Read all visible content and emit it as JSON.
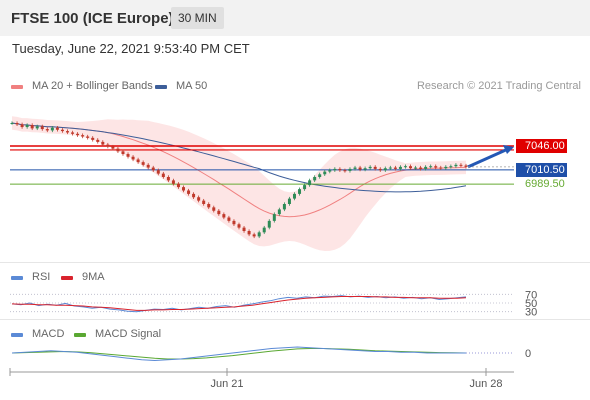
{
  "header": {
    "title": "FTSE 100 (ICE Europe)",
    "interval": "30 MIN"
  },
  "datetime": "Tuesday, June 22, 2021 9:53:40 PM CET",
  "credit": "Research © 2021 Trading Central",
  "colors": {
    "ma20": "#f08080",
    "bollinger_fill": "#fde0e0",
    "ma50": "#3d5e99",
    "resistance": "#e00000",
    "pivot": "#1e4fa8",
    "support": "#66aa33",
    "candle_up": "#2e8b57",
    "candle_down": "#c0392b",
    "arrow": "#2458b5",
    "rsi": "#5b8ad6",
    "rsi_ma": "#d9232d",
    "macd": "#5b8ad6",
    "macd_signal": "#5aa832"
  },
  "legends": {
    "main": [
      {
        "label": "MA 20 + Bollinger Bands",
        "color": "#f08080"
      },
      {
        "label": "MA 50",
        "color": "#3d5e99"
      }
    ],
    "rsi": [
      {
        "label": "RSI",
        "color": "#5b8ad6"
      },
      {
        "label": "9MA",
        "color": "#d9232d"
      }
    ],
    "macd": [
      {
        "label": "MACD",
        "color": "#5b8ad6"
      },
      {
        "label": "MACD Signal",
        "color": "#5aa832"
      }
    ]
  },
  "chart_data": [
    {
      "type": "candlestick",
      "title": "FTSE 100 (ICE Europe)",
      "ylim": [
        6880,
        7120
      ],
      "close": [
        7080,
        7078,
        7074,
        7077,
        7072,
        7075,
        7071,
        7069,
        7073,
        7070,
        7068,
        7066,
        7064,
        7062,
        7060,
        7058,
        7055,
        7052,
        7048,
        7045,
        7042,
        7038,
        7034,
        7030,
        7026,
        7022,
        7018,
        7014,
        7010,
        7005,
        7000,
        6995,
        6990,
        6985,
        6980,
        6975,
        6970,
        6965,
        6960,
        6955,
        6950,
        6945,
        6940,
        6935,
        6930,
        6925,
        6920,
        6915,
        6912,
        6918,
        6925,
        6935,
        6945,
        6952,
        6960,
        6968,
        6975,
        6982,
        6988,
        6995,
        7000,
        7004,
        7008,
        7010,
        7012,
        7010,
        7009,
        7012,
        7014,
        7011,
        7013,
        7015,
        7012,
        7010,
        7013,
        7014,
        7012,
        7015,
        7016,
        7013,
        7014,
        7012,
        7015,
        7016,
        7014,
        7013,
        7015,
        7016,
        7018,
        7017,
        7015
      ],
      "price_levels": [
        {
          "label": "7046.00",
          "value": 7046.0,
          "kind": "resistance"
        },
        {
          "label": "7010.50",
          "value": 7010.5,
          "kind": "pivot"
        },
        {
          "label": "6989.50",
          "value": 6989.5,
          "kind": "support"
        }
      ],
      "x_tick_labels": [
        "Jun 21",
        "Jun 28"
      ]
    },
    {
      "type": "line",
      "title": "RSI",
      "ylim": [
        20,
        80
      ],
      "y_levels": [
        "70",
        "50",
        "30"
      ],
      "series": [
        {
          "name": "RSI",
          "values": [
            48,
            46,
            50,
            44,
            47,
            45,
            49,
            43,
            41,
            38,
            40,
            36,
            34,
            31,
            30,
            33,
            36,
            35,
            38,
            34,
            37,
            40,
            38,
            42,
            44,
            40,
            45,
            48,
            52,
            55,
            60,
            63,
            61,
            64,
            62,
            66,
            65,
            67,
            64,
            66,
            63,
            65,
            62,
            64,
            61,
            63,
            60,
            62,
            58,
            60,
            62,
            64
          ]
        },
        {
          "name": "9MA",
          "values": [
            48,
            47,
            47,
            46,
            46,
            45,
            45,
            44,
            43,
            41,
            40,
            39,
            37,
            35,
            33,
            33,
            34,
            34,
            35,
            35,
            36,
            37,
            38,
            39,
            40,
            41,
            43,
            45,
            48,
            51,
            54,
            57,
            59,
            61,
            62,
            63,
            64,
            65,
            65,
            65,
            65,
            64,
            64,
            63,
            63,
            62,
            62,
            62,
            61,
            61,
            61,
            62
          ]
        }
      ]
    },
    {
      "type": "line",
      "title": "MACD",
      "ylim": [
        -12,
        12
      ],
      "y_levels": [
        "0"
      ],
      "series": [
        {
          "name": "MACD",
          "values": [
            0,
            1,
            2,
            3,
            2,
            1,
            -1,
            -3,
            -5,
            -7,
            -9,
            -10,
            -9,
            -8,
            -6,
            -4,
            -2,
            0,
            2,
            4,
            6,
            7,
            8,
            7,
            6,
            5,
            4,
            3,
            2,
            2,
            1,
            1,
            0,
            0,
            0,
            0
          ]
        },
        {
          "name": "MACD Signal",
          "values": [
            0,
            0.5,
            1,
            1.5,
            2,
            1.5,
            0.5,
            -1,
            -2.5,
            -4,
            -5.5,
            -7,
            -8,
            -8,
            -7.5,
            -6.5,
            -5,
            -3.5,
            -1.5,
            0.5,
            2.5,
            4,
            5.5,
            6,
            6,
            5.5,
            5,
            4,
            3,
            2.5,
            2,
            1.5,
            1,
            0.5,
            0.3,
            0
          ]
        }
      ]
    }
  ]
}
